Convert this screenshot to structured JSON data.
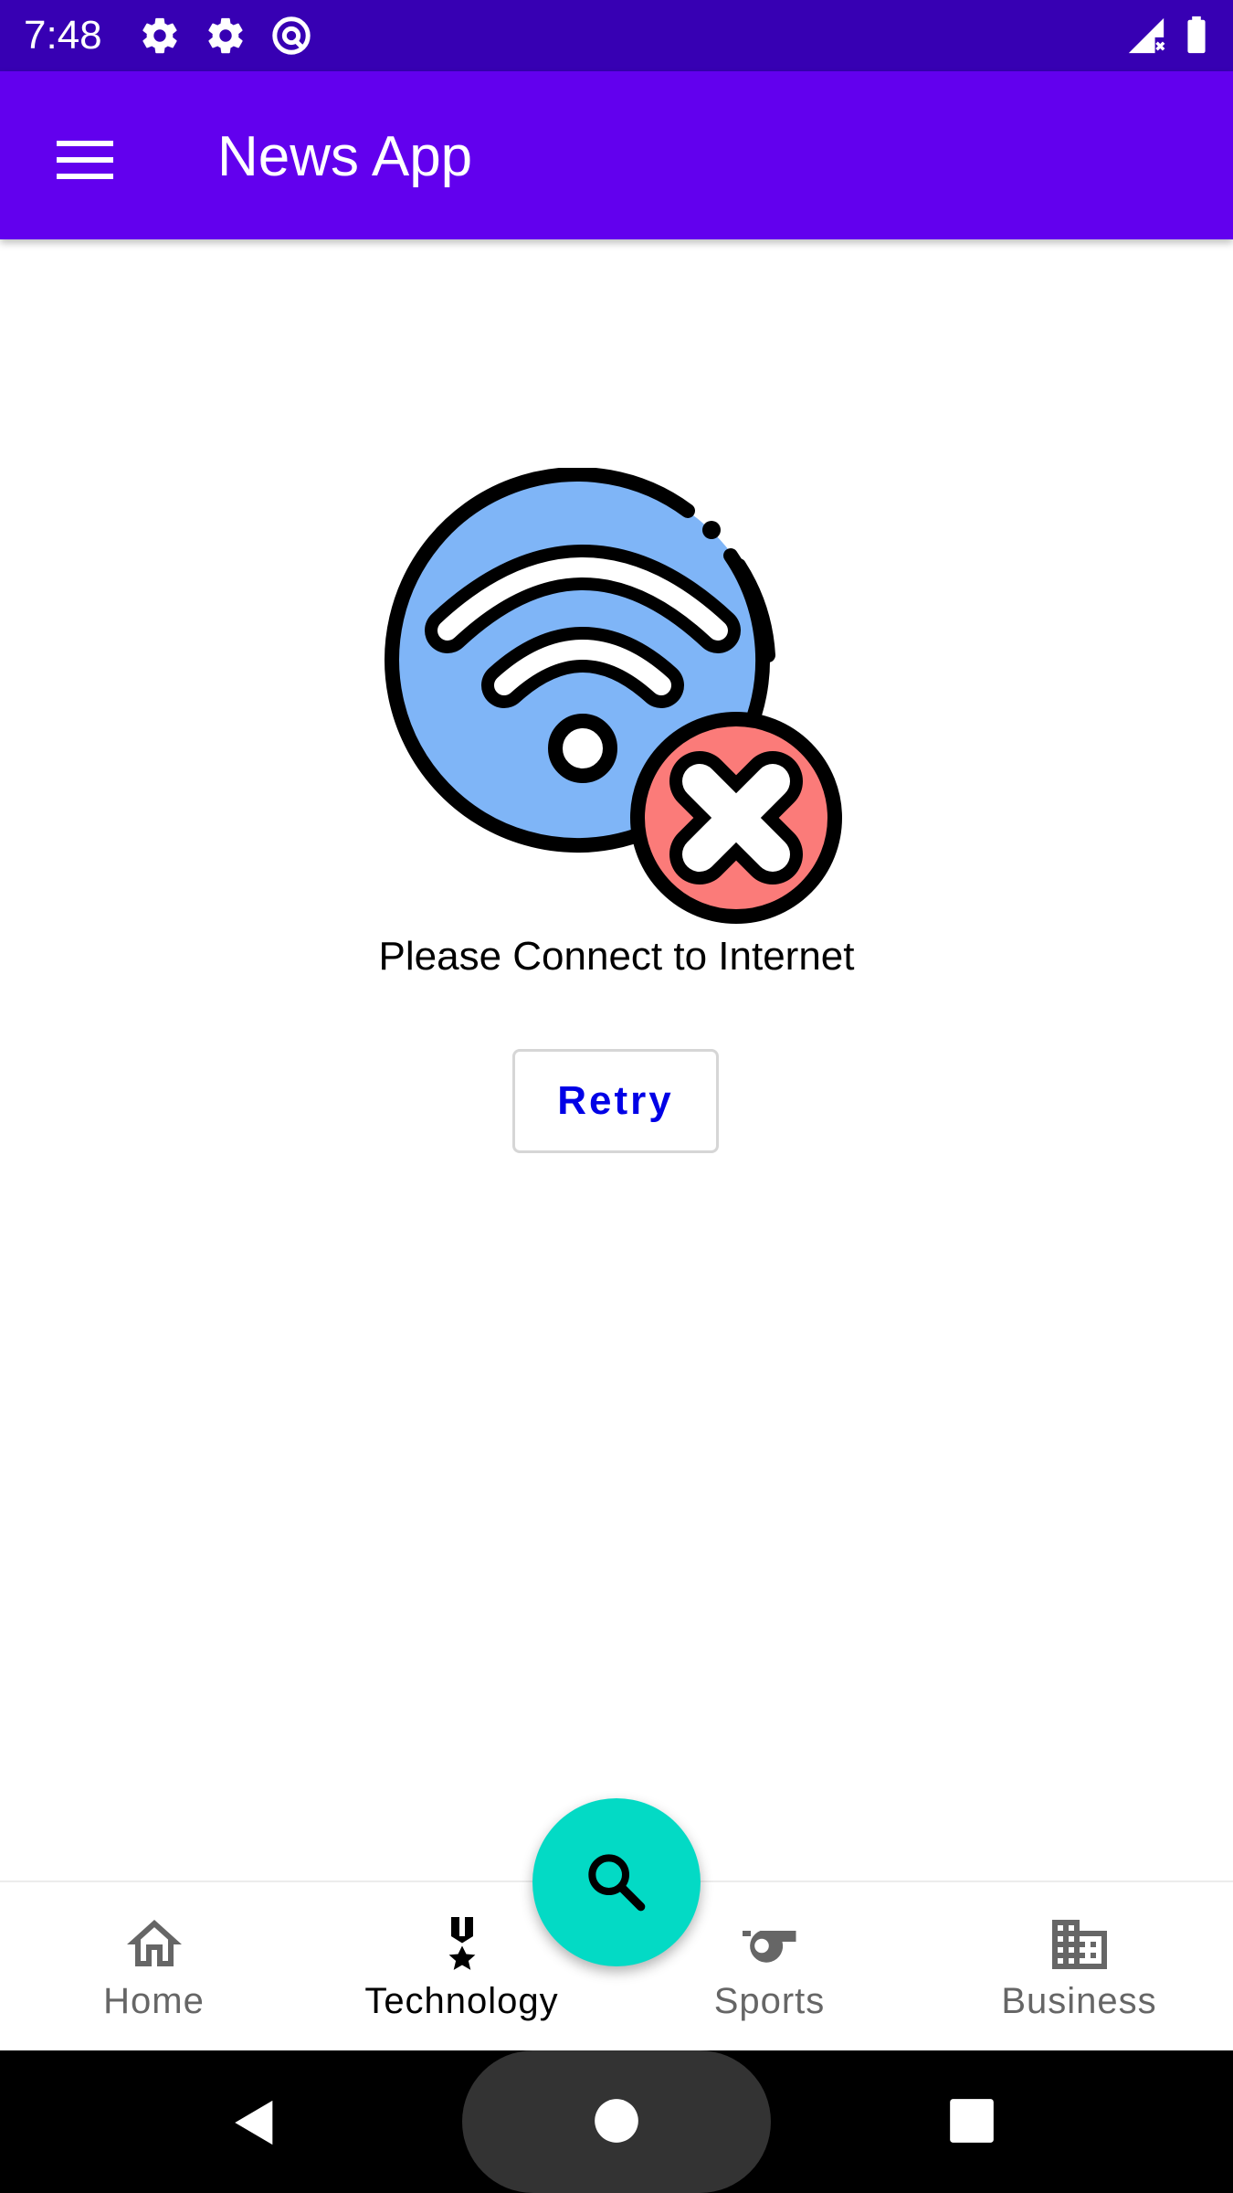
{
  "status_bar": {
    "time": "7:48",
    "icons": [
      "settings-icon",
      "settings-icon",
      "at-sign-icon",
      "signal-off-icon",
      "battery-icon"
    ]
  },
  "app_bar": {
    "title": "News App",
    "menu_icon": "menu-icon",
    "background": "#6200ee"
  },
  "main": {
    "illustration": "no-wifi-icon",
    "message": "Please Connect to Internet",
    "retry_label": "Retry"
  },
  "fab": {
    "icon": "search-icon",
    "color": "#03dac5"
  },
  "bottom_nav": {
    "items": [
      {
        "label": "Home",
        "icon": "home-icon",
        "active": false
      },
      {
        "label": "Technology",
        "icon": "medal-icon",
        "active": true
      },
      {
        "label": "Sports",
        "icon": "whistle-icon",
        "active": false
      },
      {
        "label": "Business",
        "icon": "business-building-icon",
        "active": false
      }
    ]
  },
  "system_nav": {
    "buttons": [
      "back-icon",
      "home-circle-icon",
      "recents-icon"
    ]
  },
  "colors": {
    "status_bar": "#3700b3",
    "accent_text": "#0000e6",
    "illustration_blue": "#7fb5f7",
    "illustration_red": "#fb7b79"
  }
}
